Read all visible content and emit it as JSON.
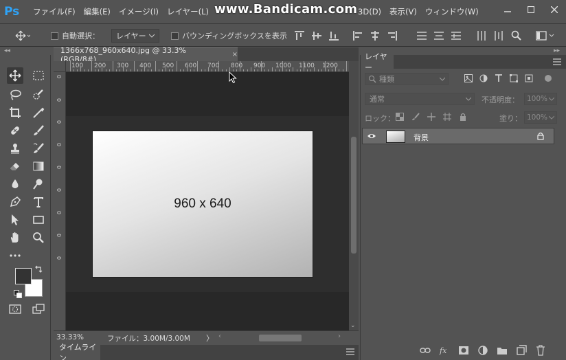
{
  "menubar": {
    "logo": "Ps",
    "items": [
      "ファイル(F)",
      "編集(E)",
      "イメージ(I)",
      "レイヤー(L)",
      "",
      "3D(D)",
      "表示(V)",
      "ウィンドウ(W)"
    ],
    "watermark": "www.Bandicam.com"
  },
  "optionsbar": {
    "auto_select_label": "自動選択：",
    "auto_select_value": "レイヤー",
    "bounding_box_label": "バウンディングボックスを表示"
  },
  "document": {
    "tab_title": "1366x768_960x640.jpg @ 33.3% (RGB/8#)",
    "tab_close": "×",
    "image_text": "960 x 640",
    "ruler_top": [
      "100",
      "200",
      "300",
      "400",
      "500",
      "600",
      "700",
      "800",
      "900",
      "1000",
      "1100",
      "1200"
    ],
    "ruler_left": [
      "0",
      "0",
      "0",
      "0",
      "0",
      "0",
      "0",
      "0",
      "0"
    ]
  },
  "statusbar": {
    "zoom": "33.33%",
    "file_info": "ファイル：3.00M/3.00M",
    "arrow": "〉"
  },
  "timeline": {
    "tab_label": "タイムライン"
  },
  "layers_panel": {
    "tab_label": "レイヤー",
    "filter_placeholder": "種類",
    "blend_mode": "通常",
    "opacity_label": "不透明度：",
    "opacity_value": "100%",
    "lock_label": "ロック：",
    "fill_label": "塗り：",
    "fill_value": "100%",
    "layers": [
      {
        "name": "背景",
        "visible": true,
        "locked": true
      }
    ]
  },
  "colors": {
    "accent": "#2fa3f7",
    "ui_bg": "#535353",
    "canvas_bg": "#282828"
  }
}
